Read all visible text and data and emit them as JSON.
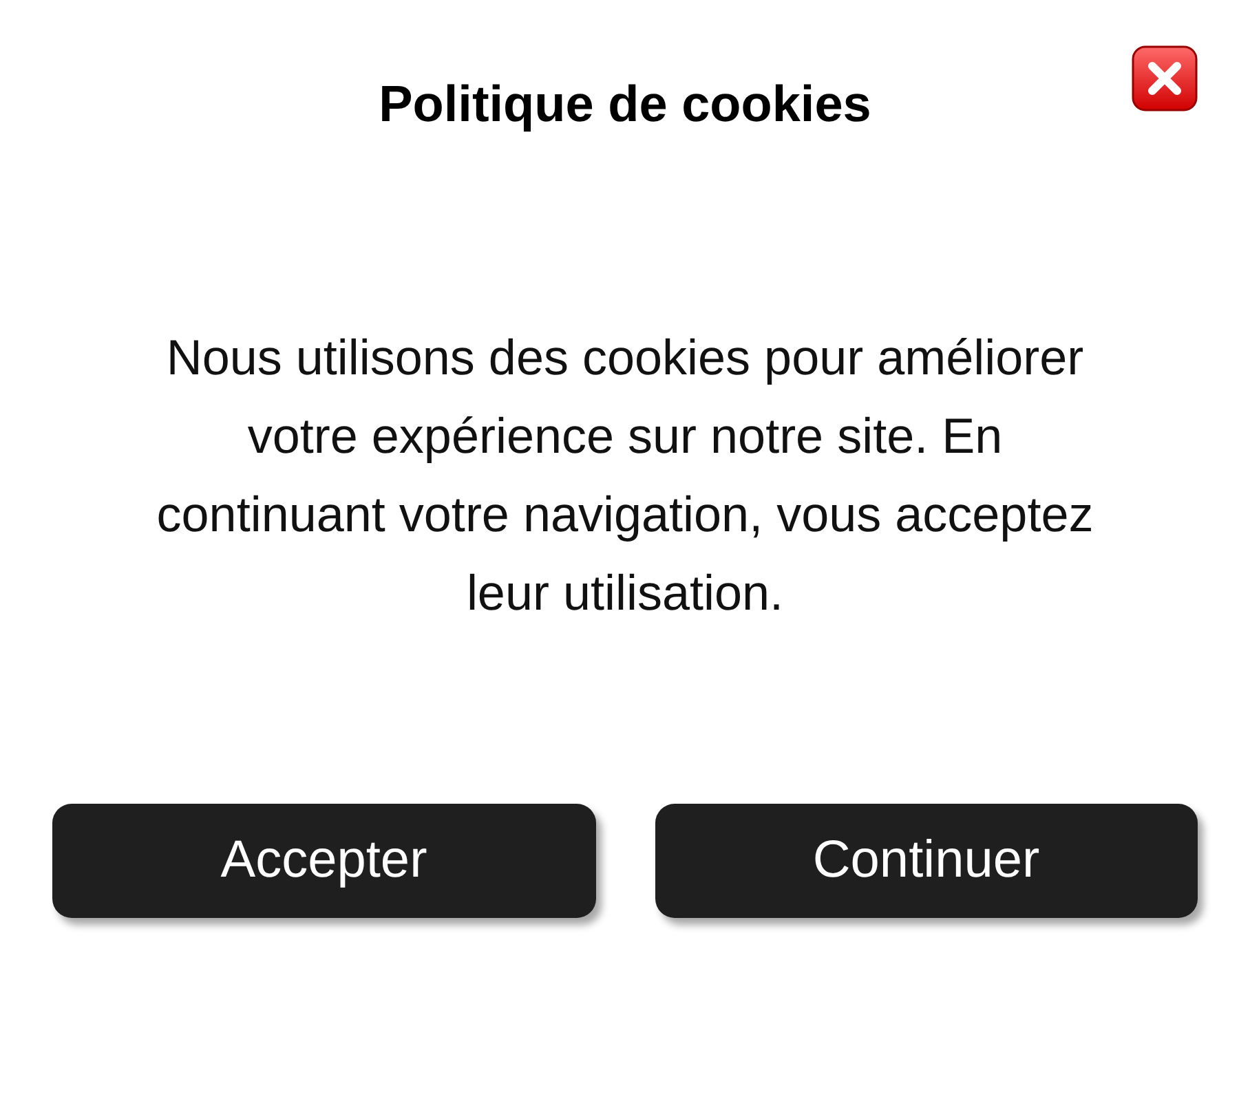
{
  "dialog": {
    "title": "Politique de cookies",
    "message": "Nous utilisons des cookies pour améliorer votre expérience sur notre site. En continuant votre navigation, vous acceptez leur utilisation."
  },
  "buttons": [
    {
      "label": "Accepter"
    },
    {
      "label": "Continuer"
    }
  ]
}
